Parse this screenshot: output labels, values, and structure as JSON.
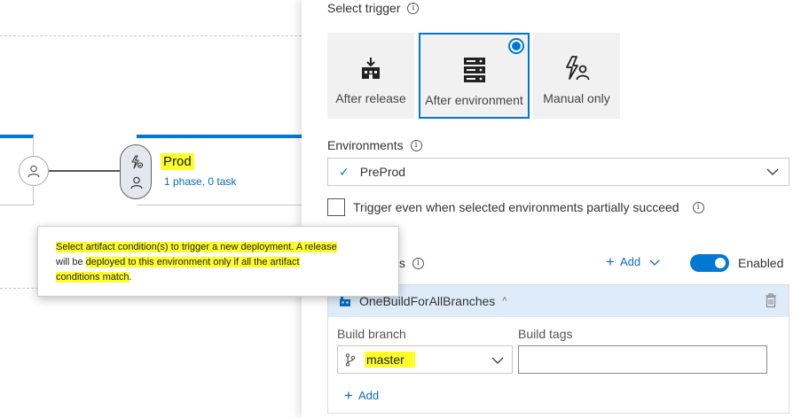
{
  "canvas": {
    "environment": {
      "title": "Prod",
      "subtitle": "1 phase, 0 task"
    },
    "tooltip": {
      "part1": "Select artifact condition(s) to trigger a new deployment. A release",
      "part2_pre": "will be ",
      "part2_hl": "deployed to this environment only if all the artifact",
      "part3": "conditions match",
      "part3_end": "."
    }
  },
  "panel": {
    "select_trigger_label": "Select trigger",
    "triggers": [
      {
        "label": "After release",
        "icon": "after-release-icon",
        "selected": false
      },
      {
        "label": "After environment",
        "icon": "after-environment-icon",
        "selected": true
      },
      {
        "label": "Manual only",
        "icon": "manual-only-icon",
        "selected": false
      }
    ],
    "environments_label": "Environments",
    "environments_value": "PreProd",
    "partial_succeed_label": "Trigger even when selected environments partially succeed",
    "artifact_filters_label": "s",
    "add_label": "Add",
    "enabled_label": "Enabled",
    "artifact": {
      "name": "OneBuildForAllBranches",
      "build_branch_label": "Build branch",
      "build_tags_label": "Build tags",
      "branch_value": "master",
      "tags_value": "",
      "add_label": "Add"
    }
  },
  "colors": {
    "accent": "#0078d4",
    "highlight": "#fdfd2a",
    "link": "#0b6cbd"
  }
}
